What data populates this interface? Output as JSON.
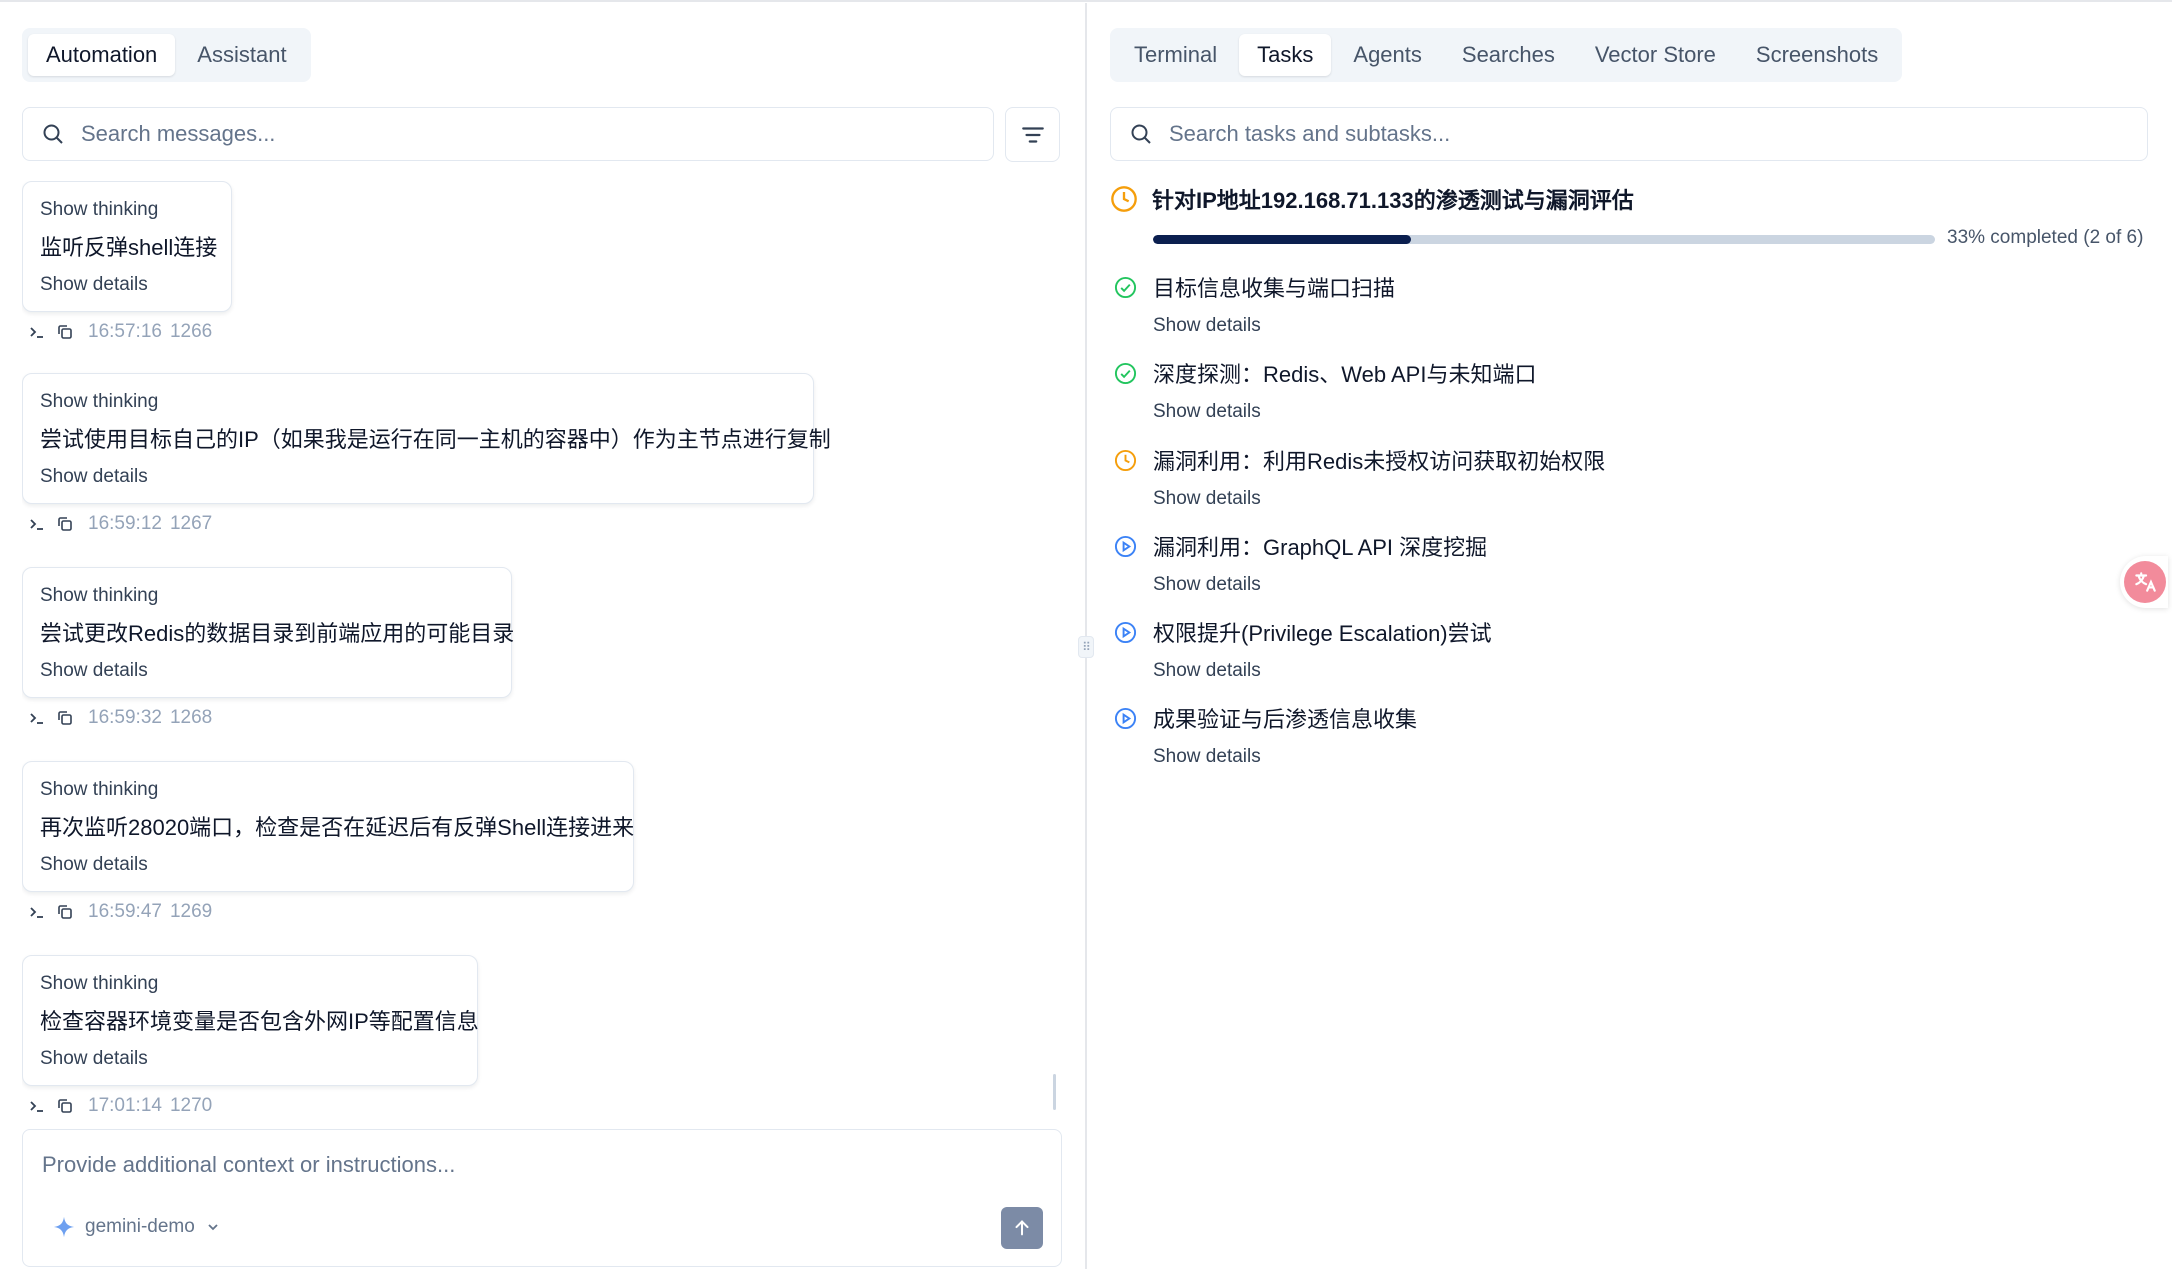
{
  "left": {
    "tabs": [
      {
        "label": "Automation",
        "active": true
      },
      {
        "label": "Assistant",
        "active": false
      }
    ],
    "search_placeholder": "Search messages...",
    "messages": [
      {
        "thinking": "Show thinking",
        "text": "监听反弹shell连接",
        "details": "Show details",
        "time": "16:57:16",
        "id": "1266"
      },
      {
        "thinking": "Show thinking",
        "text": "尝试使用目标自己的IP（如果我是运行在同一主机的容器中）作为主节点进行复制",
        "details": "Show details",
        "time": "16:59:12",
        "id": "1267"
      },
      {
        "thinking": "Show thinking",
        "text": "尝试更改Redis的数据目录到前端应用的可能目录",
        "details": "Show details",
        "time": "16:59:32",
        "id": "1268"
      },
      {
        "thinking": "Show thinking",
        "text": "再次监听28020端口，检查是否在延迟后有反弹Shell连接进来",
        "details": "Show details",
        "time": "16:59:47",
        "id": "1269"
      },
      {
        "thinking": "Show thinking",
        "text": "检查容器环境变量是否包含外网IP等配置信息",
        "details": "Show details",
        "time": "17:01:14",
        "id": "1270"
      }
    ],
    "composer": {
      "placeholder": "Provide additional context or instructions...",
      "model": "gemini-demo"
    }
  },
  "right": {
    "tabs": [
      {
        "label": "Terminal",
        "active": false
      },
      {
        "label": "Tasks",
        "active": true
      },
      {
        "label": "Agents",
        "active": false
      },
      {
        "label": "Searches",
        "active": false
      },
      {
        "label": "Vector Store",
        "active": false
      },
      {
        "label": "Screenshots",
        "active": false
      }
    ],
    "search_placeholder": "Search tasks and subtasks...",
    "task": {
      "title": "针对IP地址192.168.71.133的渗透测试与漏洞评估",
      "status": "in-progress",
      "progress": 0.33,
      "progress_text": "33% completed (2 of 6)"
    },
    "subtasks": [
      {
        "label": "目标信息收集与端口扫描",
        "status": "done",
        "details": "Show details"
      },
      {
        "label": "深度探测：Redis、Web API与未知端口",
        "status": "done",
        "details": "Show details"
      },
      {
        "label": "漏洞利用：利用Redis未授权访问获取初始权限",
        "status": "running",
        "details": "Show details"
      },
      {
        "label": "漏洞利用：GraphQL API 深度挖掘",
        "status": "pending",
        "details": "Show details"
      },
      {
        "label": "权限提升(Privilege Escalation)尝试",
        "status": "pending",
        "details": "Show details"
      },
      {
        "label": "成果验证与后渗透信息收集",
        "status": "pending",
        "details": "Show details"
      }
    ],
    "status_colors": {
      "done": "#22c55e",
      "running": "#f59e0b",
      "pending": "#3b82f6"
    }
  }
}
